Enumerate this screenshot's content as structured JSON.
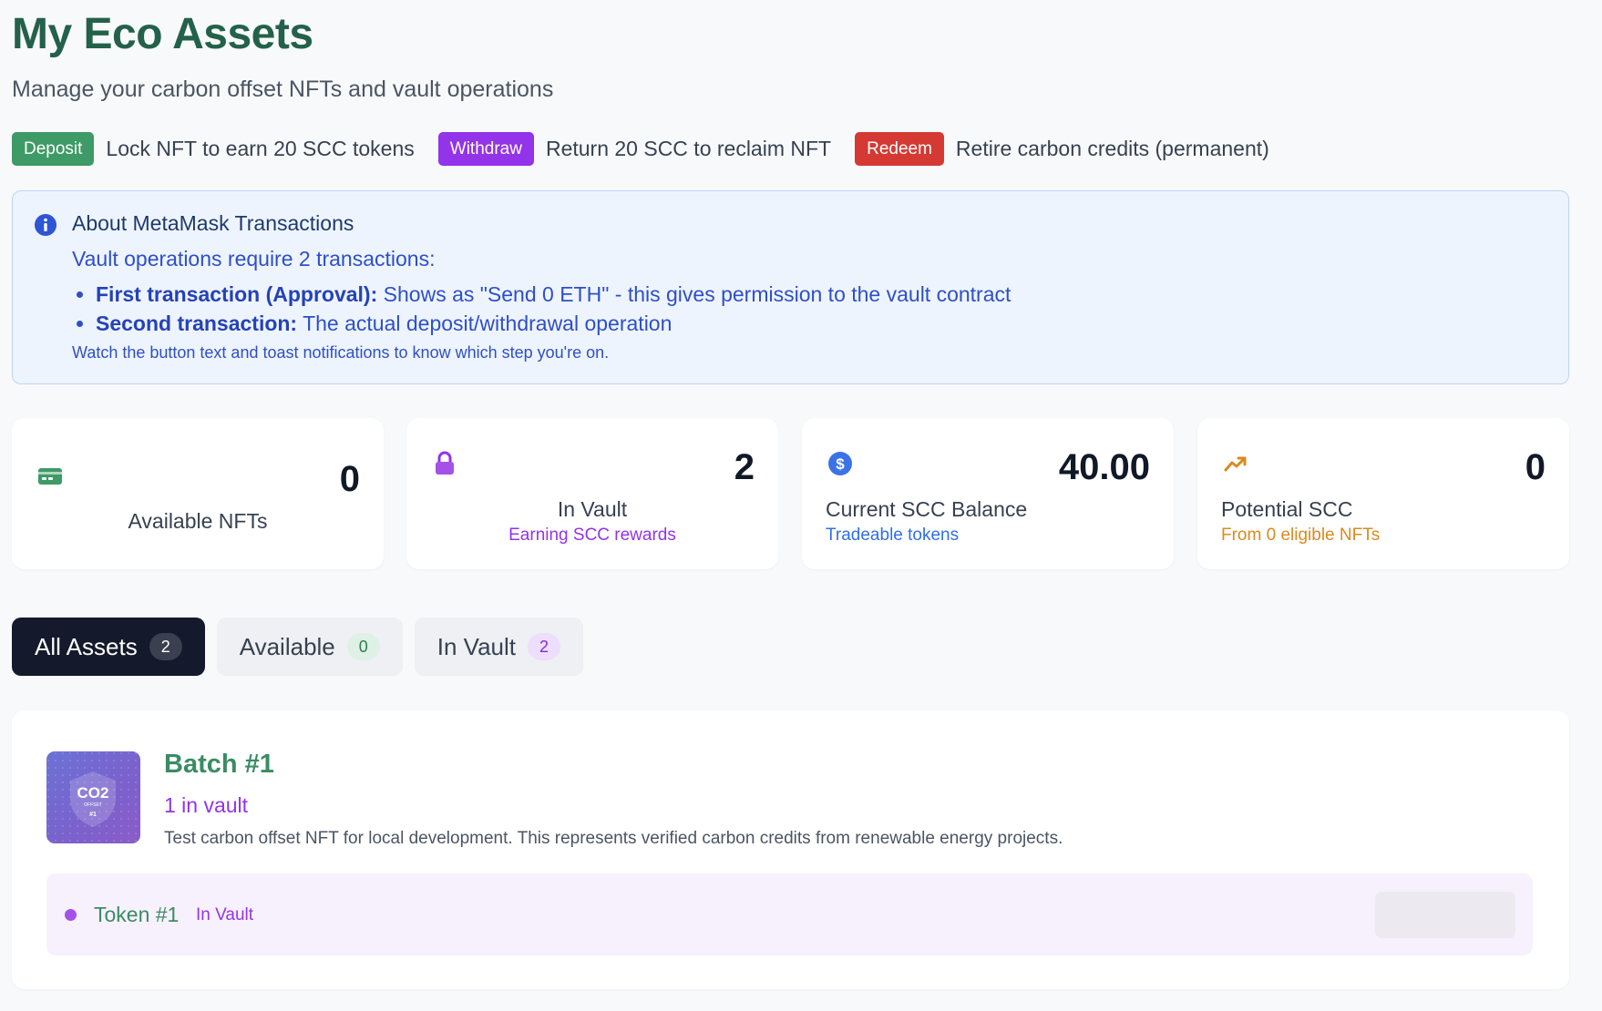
{
  "header": {
    "title": "My Eco Assets",
    "subtitle": "Manage your carbon offset NFTs and vault operations"
  },
  "legend": [
    {
      "badge": "Deposit",
      "text": "Lock NFT to earn 20 SCC tokens",
      "color": "#3e9a66"
    },
    {
      "badge": "Withdraw",
      "text": "Return 20 SCC to reclaim NFT",
      "color": "#9333ea"
    },
    {
      "badge": "Redeem",
      "text": "Retire carbon credits (permanent)",
      "color": "#d43a33"
    }
  ],
  "info": {
    "title": "About MetaMask Transactions",
    "lead": "Vault operations require 2 transactions:",
    "items": [
      {
        "strong": "First transaction (Approval):",
        "text": " Shows as \"Send 0 ETH\" - this gives permission to the vault contract"
      },
      {
        "strong": "Second transaction:",
        "text": " The actual deposit/withdrawal operation"
      }
    ],
    "note": "Watch the button text and toast notifications to know which step you're on."
  },
  "stats": [
    {
      "icon": "credit-card-icon",
      "value": "0",
      "label": "Available NFTs",
      "sub": "",
      "accent": "#3e9a66"
    },
    {
      "icon": "lock-icon",
      "value": "2",
      "label": "In Vault",
      "sub": "Earning SCC rewards",
      "accent": "#9333ea"
    },
    {
      "icon": "dollar-circle-icon",
      "value": "40.00",
      "label": "Current SCC Balance",
      "sub": "Tradeable tokens",
      "accent": "#2f6fe8"
    },
    {
      "icon": "trending-up-icon",
      "value": "0",
      "label": "Potential SCC",
      "sub": "From 0 eligible NFTs",
      "accent": "#d98a1f"
    }
  ],
  "tabs": [
    {
      "label": "All Assets",
      "count": "2",
      "active": true
    },
    {
      "label": "Available",
      "count": "0",
      "active": false
    },
    {
      "label": "In Vault",
      "count": "2",
      "active": false
    }
  ],
  "batch": {
    "thumb_text": "CO2",
    "thumb_sub": "OFFSET",
    "thumb_num": "#1",
    "title": "Batch #1",
    "count": "1 in vault",
    "description": "Test carbon offset NFT for local development. This represents verified carbon credits from renewable energy projects.",
    "token": {
      "name": "Token #1",
      "status": "In Vault"
    }
  }
}
